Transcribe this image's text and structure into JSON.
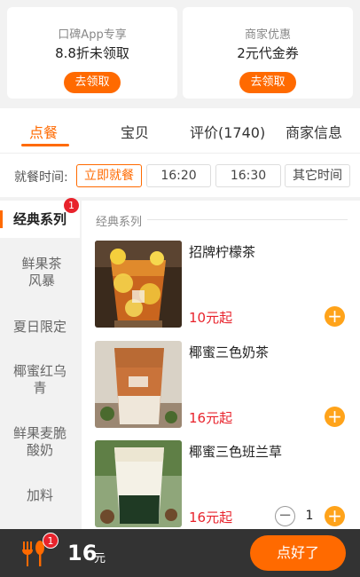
{
  "coupons": [
    {
      "title": "口碑App专享",
      "value": "8.8折未领取",
      "button": "去领取"
    },
    {
      "title": "商家优惠",
      "value": "2元代金券",
      "button": "去领取"
    }
  ],
  "tabs": [
    {
      "label": "点餐",
      "active": true
    },
    {
      "label": "宝贝",
      "active": false
    },
    {
      "label": "评价(1740)",
      "active": false
    },
    {
      "label": "商家信息",
      "active": false
    }
  ],
  "time_bar": {
    "label": "就餐时间:",
    "options": [
      "立即就餐",
      "16:20",
      "16:30",
      "其它时间"
    ],
    "selected": "立即就餐"
  },
  "categories": [
    {
      "label": "经典系列",
      "active": true,
      "badge": "1"
    },
    {
      "label": "鲜果茶风暴",
      "active": false
    },
    {
      "label": "夏日限定",
      "active": false
    },
    {
      "label": "椰蜜红乌青",
      "active": false
    },
    {
      "label": "鲜果麦脆酸奶",
      "active": false
    },
    {
      "label": "加料",
      "active": false
    }
  ],
  "section_title": "经典系列",
  "products": [
    {
      "name": "招牌柠檬茶",
      "price": "10元起",
      "quantity": null
    },
    {
      "name": "椰蜜三色奶茶",
      "price": "16元起",
      "quantity": null
    },
    {
      "name": "椰蜜三色班兰草",
      "price": "16元起",
      "quantity": "1"
    }
  ],
  "cart": {
    "badge": "1",
    "amount": "16",
    "unit": "元",
    "checkout": "点好了"
  },
  "colors": {
    "accent": "#ff6a00",
    "price": "#e8232c",
    "add_button": "#ffa31a",
    "cart_bar": "#333333"
  },
  "icons": {
    "cart": "fork-spoon-icon",
    "add": "plus-icon",
    "remove": "minus-icon"
  }
}
